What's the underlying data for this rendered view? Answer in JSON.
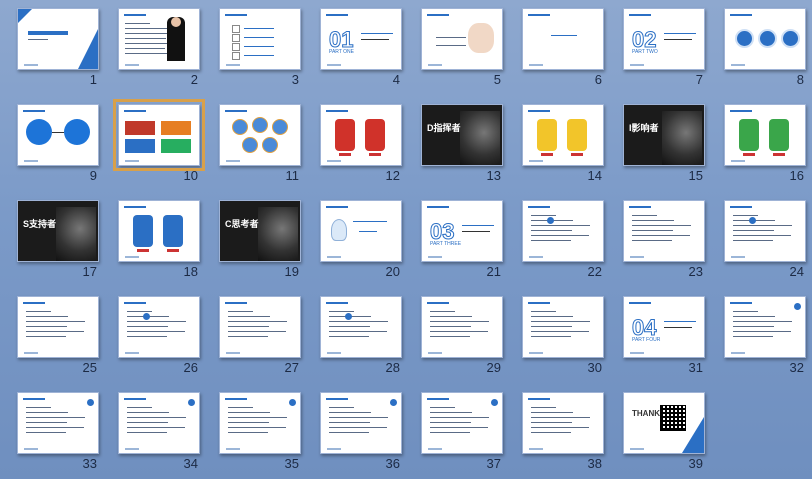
{
  "slides": [
    {
      "n": "1",
      "style": "title"
    },
    {
      "n": "2",
      "style": "profile"
    },
    {
      "n": "3",
      "style": "toc"
    },
    {
      "n": "4",
      "style": "part",
      "part": "01",
      "partword": "PART ONE"
    },
    {
      "n": "5",
      "style": "hands"
    },
    {
      "n": "6",
      "style": "blank"
    },
    {
      "n": "7",
      "style": "part",
      "part": "02",
      "partword": "PART TWO"
    },
    {
      "n": "8",
      "style": "threecircles"
    },
    {
      "n": "9",
      "style": "twocircles"
    },
    {
      "n": "10",
      "style": "fourbox",
      "selected": true
    },
    {
      "n": "11",
      "style": "cartoons"
    },
    {
      "n": "12",
      "style": "cartoons-red"
    },
    {
      "n": "13",
      "style": "dark",
      "label": "D指挥者"
    },
    {
      "n": "14",
      "style": "cartoons-yellow"
    },
    {
      "n": "15",
      "style": "dark",
      "label": "I影响者"
    },
    {
      "n": "16",
      "style": "cartoons-green"
    },
    {
      "n": "17",
      "style": "dark",
      "label": "S支持者"
    },
    {
      "n": "18",
      "style": "cartoons-blue"
    },
    {
      "n": "19",
      "style": "dark",
      "label": "C思考者"
    },
    {
      "n": "20",
      "style": "bulb"
    },
    {
      "n": "21",
      "style": "part",
      "part": "03",
      "partword": "PART THREE"
    },
    {
      "n": "22",
      "style": "text"
    },
    {
      "n": "23",
      "style": "text"
    },
    {
      "n": "24",
      "style": "text"
    },
    {
      "n": "25",
      "style": "text"
    },
    {
      "n": "26",
      "style": "text"
    },
    {
      "n": "27",
      "style": "text"
    },
    {
      "n": "28",
      "style": "text"
    },
    {
      "n": "29",
      "style": "text"
    },
    {
      "n": "30",
      "style": "text"
    },
    {
      "n": "31",
      "style": "part",
      "part": "04",
      "partword": "PART FOUR"
    },
    {
      "n": "32",
      "style": "text"
    },
    {
      "n": "33",
      "style": "text"
    },
    {
      "n": "34",
      "style": "text"
    },
    {
      "n": "35",
      "style": "text"
    },
    {
      "n": "36",
      "style": "text"
    },
    {
      "n": "37",
      "style": "text"
    },
    {
      "n": "38",
      "style": "text"
    },
    {
      "n": "39",
      "style": "thanks",
      "label": "THANKS"
    }
  ],
  "colors": {
    "accent": "#2b6fc4",
    "selection": "#d8a04a",
    "background": "#7b9ac8"
  }
}
